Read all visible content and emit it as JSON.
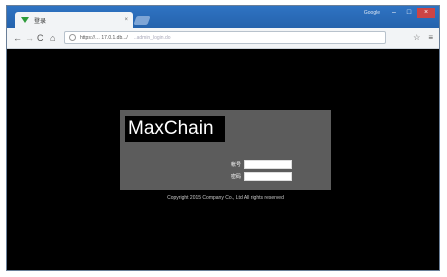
{
  "browser": {
    "tab": {
      "title": "登录",
      "close_glyph": "×"
    },
    "window_controls": {
      "user": "Google",
      "minimize": "–",
      "maximize": "□",
      "close": "×"
    },
    "toolbar": {
      "back_glyph": "←",
      "forward_glyph": "→",
      "reload_glyph": "C",
      "home_glyph": "⌂",
      "url": "https://… 17.0.1.db.../",
      "url_rest": "..admin_login.do",
      "star_glyph": "☆",
      "menu_glyph": "≡"
    }
  },
  "login": {
    "brand": "MaxChain",
    "username_label": "帐号",
    "password_label": "密码",
    "username_value": "",
    "password_value": "",
    "copyright": "Copyright 2015 Company Co., Ltd All rights reserved"
  },
  "colors": {
    "titlebar": "#2f73c3",
    "page_bg": "#000000",
    "panel_bg": "#5c5c5c"
  }
}
